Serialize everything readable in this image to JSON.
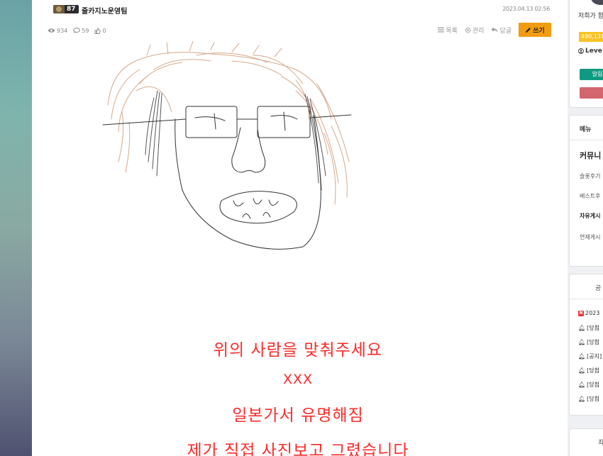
{
  "post": {
    "level": "87",
    "author": "줄카지노운영팀",
    "date": "2023.04.13 02:56",
    "views": "934",
    "comments": "59",
    "likes": "0"
  },
  "actions": {
    "list": "목록",
    "manage": "관리",
    "reply": "답글",
    "write": "쓰기"
  },
  "content": {
    "line1": "위의 사람을 맞춰주세요",
    "line2": "XXX",
    "line3": "일본가서 유명해짐",
    "line4": "제가 직접 사진보고 그렸습니다"
  },
  "sidebar": {
    "greeting": "저희가 함",
    "points": "490,131",
    "level": "Leve",
    "green_button": "알림",
    "red_button": "",
    "menu_title": "메뉴",
    "menu_heading": "커뮤니",
    "menu_items": [
      "슬롯후기",
      "베스트후",
      "자유게시",
      "연재게시"
    ],
    "notice_title": "공",
    "notice_items": [
      "2023",
      "[당첨",
      "[당첨",
      "[공지]",
      "[당첨",
      "[당첨",
      "[당첨"
    ],
    "bottom_title": "최"
  },
  "colors": {
    "accent": "#f39c12",
    "text_red": "#ff2a2a",
    "green": "#0f9a80",
    "red": "#d2656e",
    "yellow": "#f7c325"
  }
}
